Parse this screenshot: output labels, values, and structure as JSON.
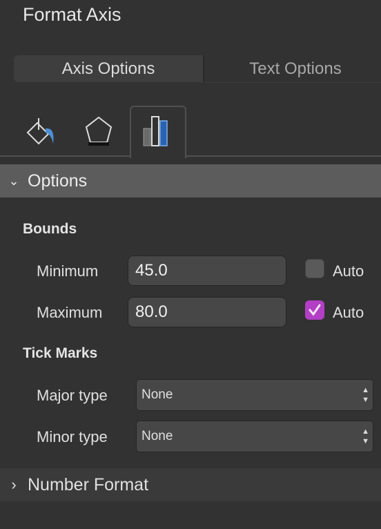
{
  "title": "Format Axis",
  "segments": {
    "axis_options": "Axis Options",
    "text_options": "Text Options",
    "selected": "Axis Options"
  },
  "icon_tabs": [
    {
      "icon": "fill-bucket-icon"
    },
    {
      "icon": "pentagon-effects-icon"
    },
    {
      "icon": "bar-chart-icon",
      "selected": true
    }
  ],
  "options": {
    "header": "Options",
    "expanded": true,
    "bounds": {
      "title": "Bounds",
      "minimum": {
        "label": "Minimum",
        "value": "45.0",
        "auto_label": "Auto",
        "auto": false
      },
      "maximum": {
        "label": "Maximum",
        "value": "80.0",
        "auto_label": "Auto",
        "auto": true
      }
    },
    "tick_marks": {
      "title": "Tick Marks",
      "major": {
        "label": "Major type",
        "value": "None"
      },
      "minor": {
        "label": "Minor type",
        "value": "None"
      }
    }
  },
  "number_format": {
    "header": "Number Format",
    "expanded": false
  },
  "colors": {
    "checkbox_checked": "#b23fc4",
    "accent_blue": "#2a63b0"
  }
}
